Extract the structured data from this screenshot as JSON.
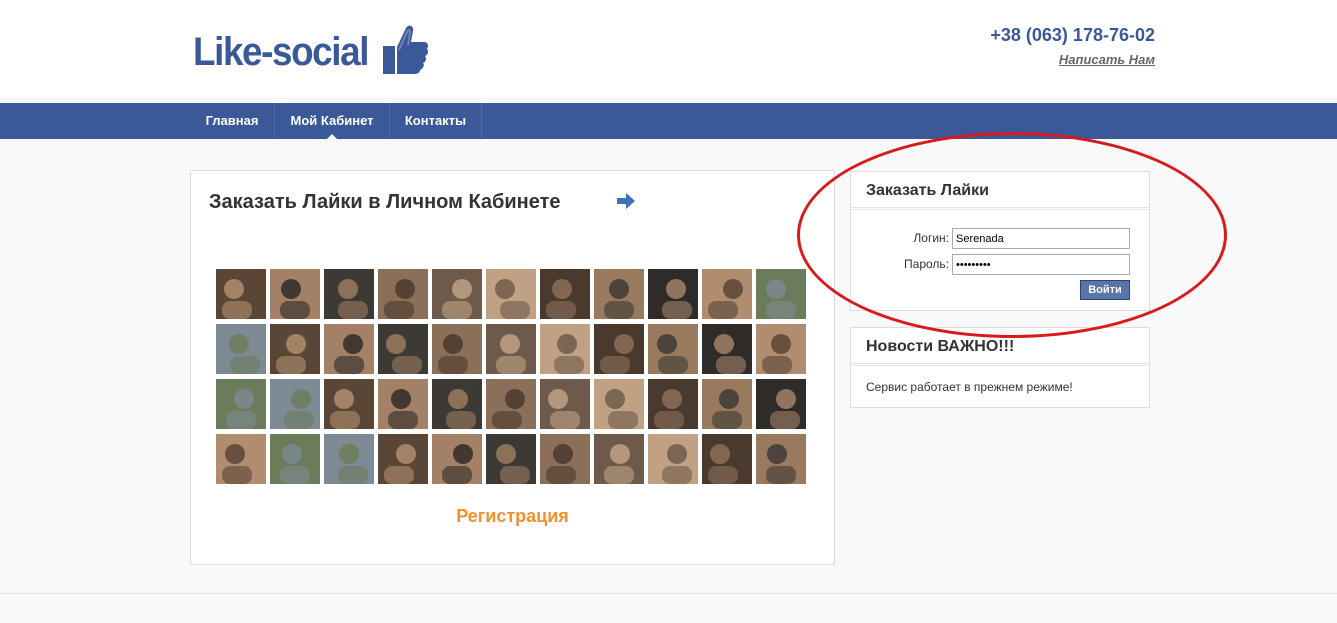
{
  "header": {
    "logo_text": "Like-social",
    "phone": "+38 (063) 178-76-02",
    "write_us": "Написать Нам"
  },
  "nav": {
    "items": [
      {
        "label": "Главная"
      },
      {
        "label": "Мой Кабинет"
      },
      {
        "label": "Контакты"
      }
    ],
    "active": "Мой Кабинет"
  },
  "main": {
    "title": "Заказать Лайки в Личном Кабинете",
    "arrow_icon": "arrow-right-icon",
    "photos_icon": "profile-photo",
    "register_link": "Регистрация"
  },
  "login_box": {
    "title": "Заказать Лайки",
    "login_label": "Логин:",
    "login_value": "Serenada",
    "password_label": "Пароль:",
    "password_value": "•••••••••",
    "submit_label": "Войти"
  },
  "news_box": {
    "title": "Новости ВАЖНО!!!",
    "text": "Сервис работает в прежнем режиме!"
  },
  "colors": {
    "brand": "#3b5998",
    "accent": "#f0912d",
    "annotation": "#d81a1a"
  }
}
